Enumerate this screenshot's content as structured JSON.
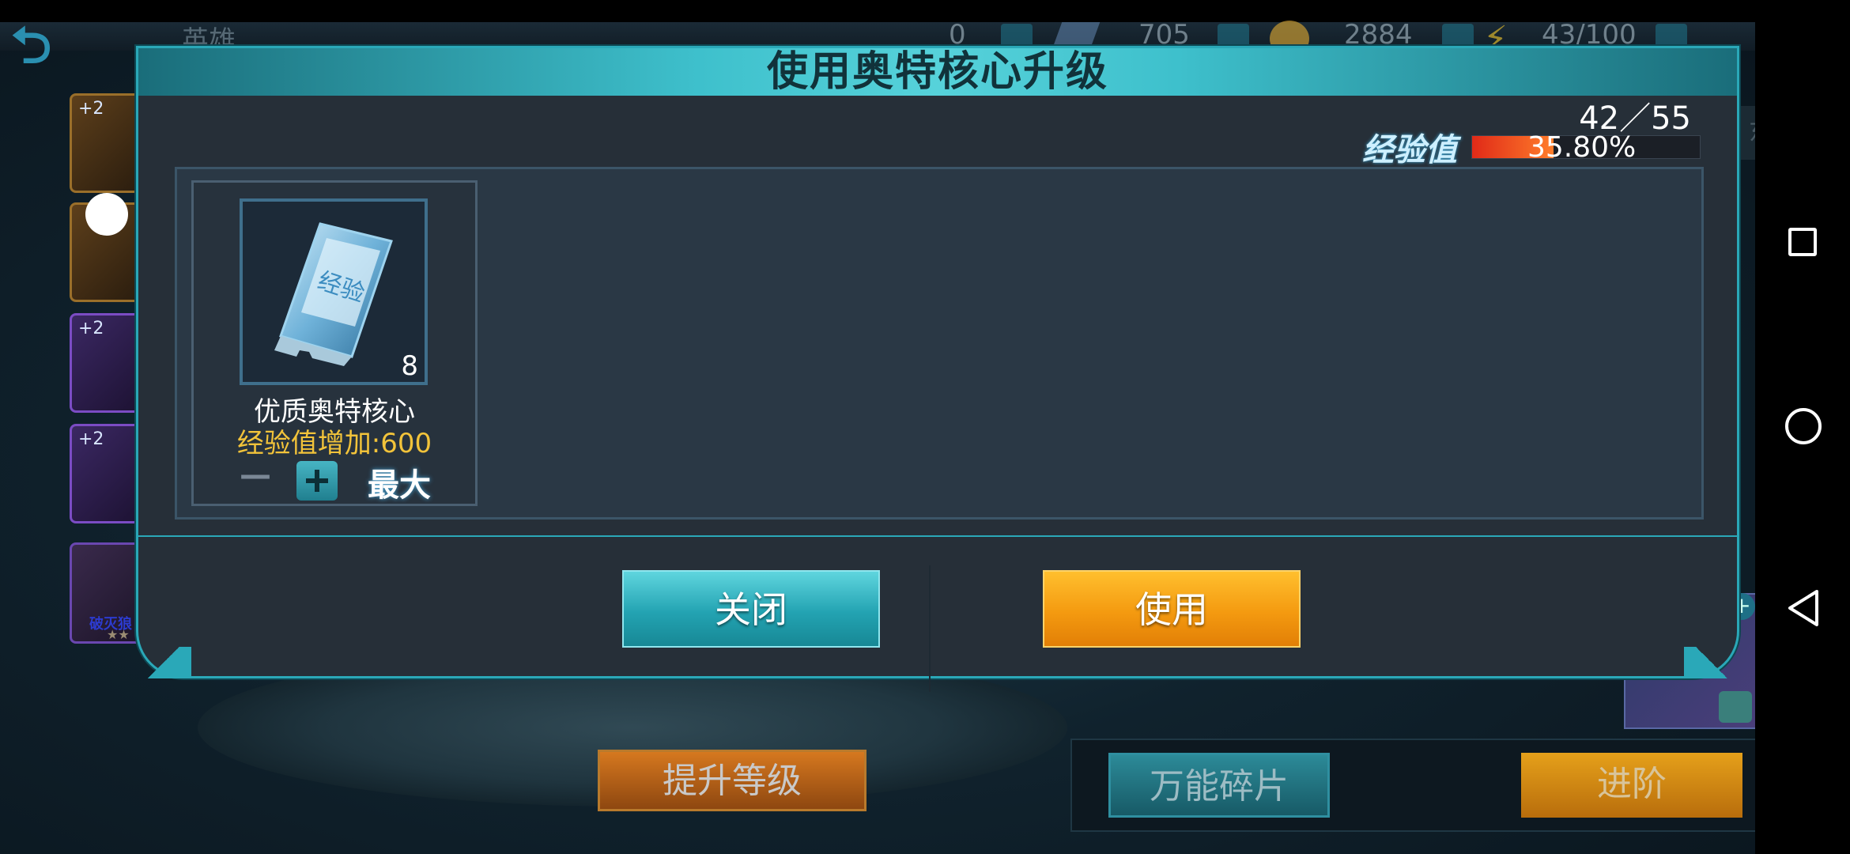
{
  "background": {
    "title": "英雄",
    "resources": [
      {
        "icon": "gem-icon",
        "value": "705"
      },
      {
        "icon": "coin-icon",
        "value": "2884"
      },
      {
        "icon": "energy-icon",
        "value": "43/100"
      }
    ],
    "first_resource": "0",
    "hero_slots": [
      {
        "tag": "+2"
      },
      {
        "tag": "+2"
      },
      {
        "tag": "+2"
      },
      {
        "tag": "+2"
      }
    ],
    "hero_portrait": {
      "name": "破灭狼",
      "stars": "★★"
    },
    "upgrade_button": "提升等级",
    "shard_button": "万能碎片",
    "advance_button": "进阶",
    "tab_label": "东"
  },
  "dialog": {
    "title": "使用奥特核心升级",
    "exp_count": "42／55",
    "exp_label": "经验值",
    "exp_percent_text": "35.80%",
    "exp_fraction": 0.358,
    "item": {
      "icon": "exp-chip-icon",
      "icon_text": "经验",
      "quantity": "8",
      "name": "优质奥特核心",
      "exp_bonus": "经验值增加:600",
      "minus": "—",
      "max_label": "最大"
    },
    "close_button": "关闭",
    "use_button": "使用"
  },
  "colors": {
    "accent_teal": "#2aa8b8",
    "button_orange": "#f49a10",
    "exp_fill": "#e02a18",
    "exp_text_gold": "#f2c33a"
  }
}
